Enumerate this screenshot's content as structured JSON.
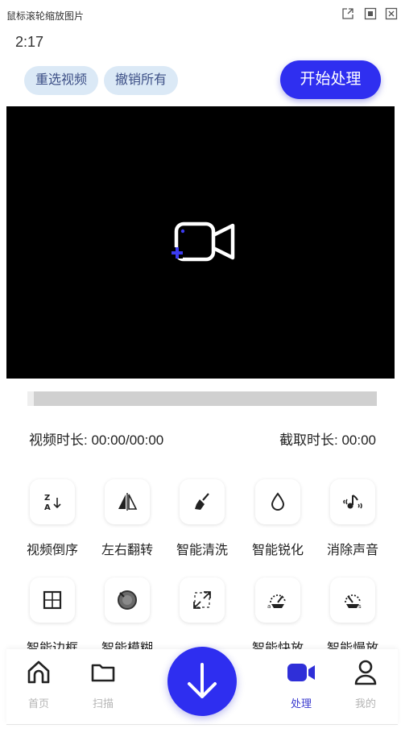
{
  "window": {
    "title": "鼠标滚轮缩放图片"
  },
  "status": {
    "time": "2:17"
  },
  "actions": {
    "reselect": "重选视频",
    "undo_all": "撤销所有",
    "start": "开始处理"
  },
  "info": {
    "video_duration": "视频时长: 00:00/00:00",
    "clip_duration": "截取时长: 00:00"
  },
  "tools": [
    {
      "label": "视频倒序",
      "icon": "sort-za-icon"
    },
    {
      "label": "左右翻转",
      "icon": "flip-horizontal-icon"
    },
    {
      "label": "智能清洗",
      "icon": "broom-icon"
    },
    {
      "label": "智能锐化",
      "icon": "droplet-icon"
    },
    {
      "label": "消除声音",
      "icon": "music-mute-icon"
    },
    {
      "label": "智能边框",
      "icon": "frame-grid-icon"
    },
    {
      "label": "智能模糊",
      "icon": "blur-lens-icon"
    },
    {
      "label": "",
      "icon": "expand-icon"
    },
    {
      "label": "智能快放",
      "icon": "speed-fast-icon"
    },
    {
      "label": "智能慢放",
      "icon": "speed-slow-icon"
    }
  ],
  "nav": [
    {
      "label": "首页",
      "icon": "home-icon",
      "active": false
    },
    {
      "label": "扫描",
      "icon": "folder-icon",
      "active": false
    },
    {
      "label": "处理",
      "icon": "video-camera-icon",
      "active": true
    },
    {
      "label": "我的",
      "icon": "person-icon",
      "active": false
    }
  ],
  "colors": {
    "accent": "#2f2ff0",
    "chip_bg": "#dbe9f6",
    "chip_text": "#3c4f86",
    "nav_inactive": "#b5b5b5"
  }
}
